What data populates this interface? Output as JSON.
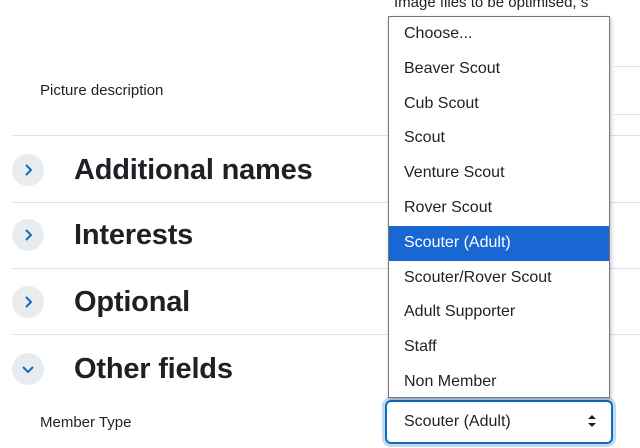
{
  "form": {
    "image_hint": "Image files to be optimised, s",
    "picture_description_label": "Picture description",
    "sections": [
      {
        "title": "Additional names",
        "expanded": false
      },
      {
        "title": "Interests",
        "expanded": false
      },
      {
        "title": "Optional",
        "expanded": false
      },
      {
        "title": "Other fields",
        "expanded": true
      }
    ],
    "member_type_label": "Member Type",
    "member_type_value": "Scouter (Adult)"
  },
  "dropdown": {
    "options": [
      "Choose...",
      "Beaver Scout",
      "Cub Scout",
      "Scout",
      "Venture Scout",
      "Rover Scout",
      "Scouter (Adult)",
      "Scouter/Rover Scout",
      "Adult Supporter",
      "Staff",
      "Non Member"
    ],
    "selected": "Scouter (Adult)"
  },
  "colors": {
    "accent": "#0f6cbf",
    "selected_option_bg": "#1967d2",
    "chevron_bg": "#e9ecef"
  },
  "icons": {
    "collapsed": "chevron-right-icon",
    "expanded": "chevron-down-icon",
    "select": "select-arrows-icon"
  }
}
